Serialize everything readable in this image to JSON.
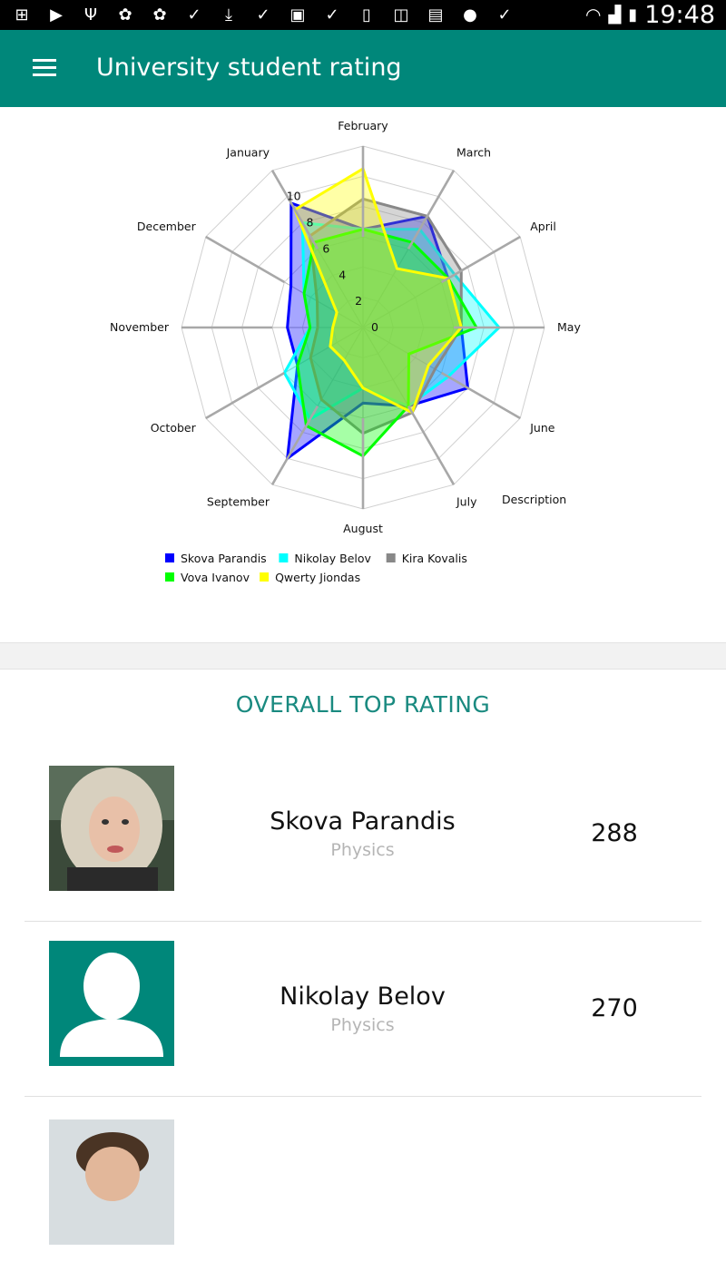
{
  "status_bar": {
    "time": "19:48",
    "icons": [
      "add-box-icon",
      "youtube-icon",
      "usb-icon",
      "paw-icon",
      "paw-icon",
      "check-icon",
      "download-icon",
      "check-icon",
      "android-icon",
      "check-icon",
      "phone-vibrate-icon",
      "nfc-icon",
      "document-icon",
      "galaxy-icon",
      "check-icon",
      "wifi-icon",
      "signal-icon",
      "battery-icon"
    ]
  },
  "app_bar": {
    "title": "University student rating",
    "background": "#00877a"
  },
  "chart_data": {
    "type": "radar",
    "axes": [
      "February",
      "March",
      "April",
      "May",
      "June",
      "July",
      "August",
      "September",
      "October",
      "November",
      "December",
      "January"
    ],
    "r_ticks": [
      "0",
      "2",
      "4",
      "6",
      "8",
      "10"
    ],
    "rlim": [
      0,
      12
    ],
    "description_label": "Description",
    "legend_position": "bottom-left",
    "series": [
      {
        "name": "Skova Parandis",
        "color": "#0000ff",
        "values": [
          6.5,
          8.5,
          6.5,
          6.5,
          8.0,
          6.0,
          5.0,
          10.0,
          5.0,
          5.0,
          5.5,
          9.5
        ]
      },
      {
        "name": "Nikolay Belov",
        "color": "#00ffff",
        "values": [
          6.5,
          7.5,
          7.0,
          9.0,
          6.5,
          6.0,
          4.0,
          7.0,
          6.0,
          3.5,
          4.5,
          8.0
        ]
      },
      {
        "name": "Kira Kovalis",
        "color": "#888888",
        "values": [
          8.5,
          8.5,
          7.5,
          6.5,
          5.5,
          6.5,
          7.0,
          5.5,
          4.0,
          3.0,
          3.5,
          7.0
        ]
      },
      {
        "name": "Vova Ivanov",
        "color": "#00ff00",
        "values": [
          6.5,
          6.5,
          6.5,
          7.5,
          3.5,
          6.0,
          8.5,
          7.5,
          5.0,
          3.5,
          4.5,
          6.5
        ]
      },
      {
        "name": "Qwerty Jiondas",
        "color": "#ffff00",
        "values": [
          10.5,
          4.5,
          6.5,
          6.5,
          5.0,
          6.5,
          4.0,
          2.5,
          2.5,
          2.0,
          2.0,
          9.0
        ]
      }
    ]
  },
  "rating": {
    "title": "OVERALL TOP RATING",
    "students": [
      {
        "name": "Skova Parandis",
        "department": "Physics",
        "score": "288"
      },
      {
        "name": "Nikolay Belov",
        "department": "Physics",
        "score": "270"
      }
    ]
  }
}
